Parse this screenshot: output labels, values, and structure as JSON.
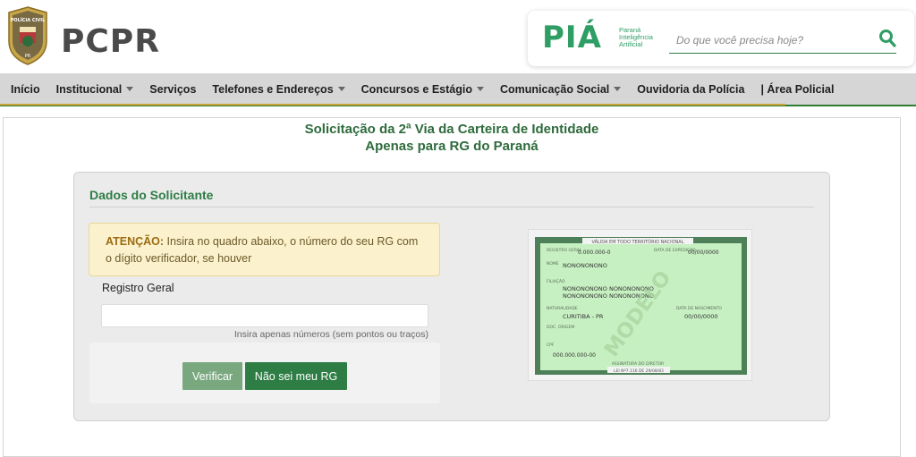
{
  "header": {
    "logo_badge_text": "POLÍCIA CIVIL",
    "logo_badge_sub": "PR",
    "logo_text": "PCPR",
    "pia_word": "PIÁ",
    "pia_sub_1": "Paraná",
    "pia_sub_2": "Inteligência",
    "pia_sub_3": "Artificial",
    "search_placeholder": "Do que você precisa hoje?"
  },
  "nav": {
    "items": [
      {
        "label": "Início",
        "dropdown": false
      },
      {
        "label": "Institucional",
        "dropdown": true
      },
      {
        "label": "Serviços",
        "dropdown": false
      },
      {
        "label": "Telefones e Endereços",
        "dropdown": true
      },
      {
        "label": "Concursos e Estágio",
        "dropdown": true
      },
      {
        "label": "Comunicação Social",
        "dropdown": true
      },
      {
        "label": "Ouvidoria da Polícia",
        "dropdown": false
      },
      {
        "label": "| Área Policial",
        "dropdown": false
      }
    ]
  },
  "page": {
    "title_line1": "Solicitação da 2ª Via da Carteira de Identidade",
    "title_line2": "Apenas para RG do Paraná"
  },
  "form": {
    "section_title": "Dados do Solicitante",
    "alert_strong": "ATENÇÃO:",
    "alert_text": " Insira no quadro abaixo, o número do seu RG com o dígito verificador, se houver",
    "rg_label": "Registro Geral",
    "rg_value": "",
    "rg_help": "Insira apenas números (sem pontos ou traços)",
    "verify_label": "Verificar",
    "nosei_label": "Não sei meu RG"
  },
  "id_card": {
    "top_banner": "VÁLIDA EM TODO TERRITÓRIO NACIONAL",
    "registro_label": "REGISTRO GERAL",
    "registro_value": "0.000.000-0",
    "expedicao_label": "DATA DE EXPEDIÇÃO",
    "expedicao_value": "00/00/0000",
    "nome_label": "NOME",
    "nome_value": "NONONONONO",
    "filiacao_label": "FILIAÇÃO",
    "filiacao_1": "NONONONONO NONONONONO",
    "filiacao_2": "NONONONONO NONONONONO",
    "naturalidade_label": "NATURALIDADE",
    "naturalidade_value": "CURITIBA - PR",
    "nascimento_label": "DATA DE NASCIMENTO",
    "nascimento_value": "00/00/0000",
    "doc_origem_label": "DOC. ORIGEM",
    "cpf_label": "CPF",
    "cpf_value": "000.000.000-00",
    "watermark": "MODELO",
    "assinatura_label": "ASSINATURA DO DIRETOR",
    "lei_label": "LEI Nº7.116 DE 29/08/83",
    "card_color": "#c7f0c2",
    "frame_color": "#4d7f58"
  }
}
